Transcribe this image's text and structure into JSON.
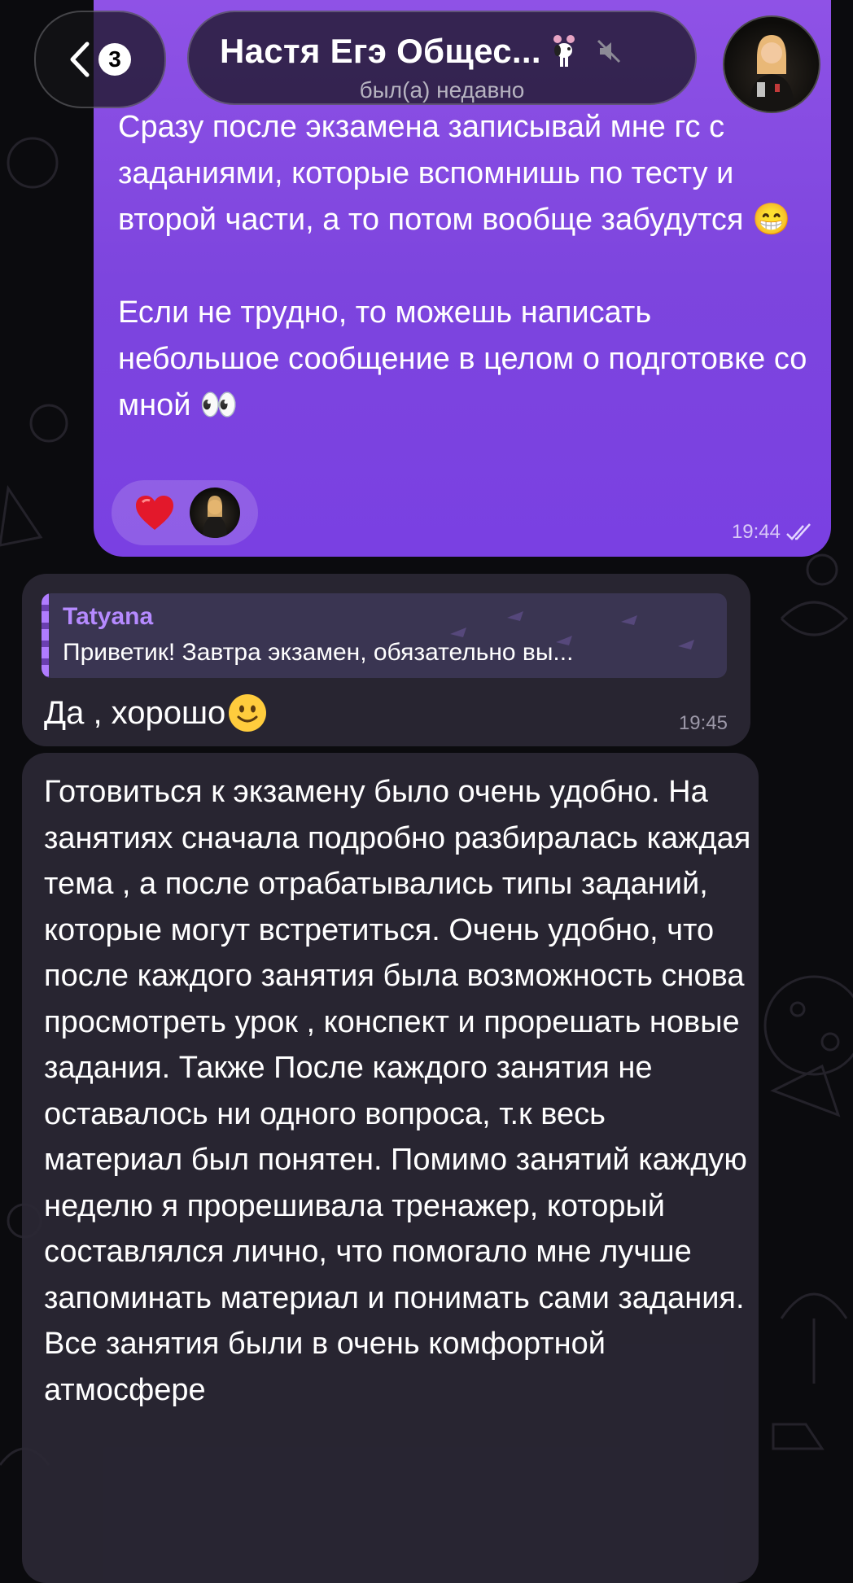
{
  "header": {
    "back_badge": "3",
    "title": "Настя Егэ Общес...",
    "status": "был(а) недавно",
    "status_emoji_icon": "snoopy-icon",
    "mute_icon": "mute-icon"
  },
  "messages": [
    {
      "type": "outgoing",
      "text": "Сразу после экзамена записывай мне гс с заданиями, которые вспомнишь по тесту и второй части, а то потом вообще забудутся 😁\n\nЕсли не трудно, то можешь написать небольшое сообщение в целом о подготовке со мной 👀",
      "reactions": [
        "❤️",
        "avatar"
      ],
      "time": "19:44",
      "read": true
    },
    {
      "type": "incoming",
      "reply_author": "Tatyana",
      "reply_text": "Приветик! Завтра экзамен, обязательно вы...",
      "text": "Да , хорошо",
      "emoji": "🙂",
      "time": "19:45"
    },
    {
      "type": "incoming",
      "text": "Готовиться к экзамену было очень удобно. На занятиях сначала подробно разбиралась каждая тема , а после отрабатывались типы заданий, которые могут встретиться. Очень удобно, что после каждого занятия была возможность снова просмотреть урок , конспект и прорешать новые задания. Также После каждого занятия не оставалось ни одного вопроса, т.к весь материал был понятен. Помимо занятий каждую неделю я прорешивала тренажер, который составлялся лично, что помогало мне лучше запоминать материал и понимать сами задания. Все занятия были в очень комфортной атмосфере"
    }
  ],
  "colors": {
    "outgoing_bubble": "#8a4ce4",
    "incoming_bubble": "#2a2734",
    "accent": "#b58aff"
  }
}
